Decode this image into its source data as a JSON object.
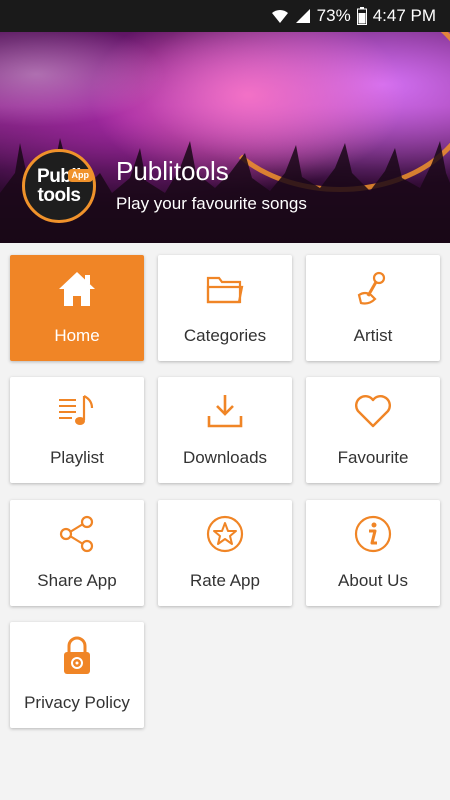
{
  "status_bar": {
    "battery": "73%",
    "time": "4:47 PM"
  },
  "header": {
    "logo_line1": "Publi",
    "logo_line2": "tools",
    "logo_badge": "App",
    "title": "Publitools",
    "subtitle": "Play your favourite songs"
  },
  "menu": [
    {
      "label": "Home",
      "icon": "home-icon",
      "active": true
    },
    {
      "label": "Categories",
      "icon": "folder-icon",
      "active": false
    },
    {
      "label": "Artist",
      "icon": "microphone-icon",
      "active": false
    },
    {
      "label": "Playlist",
      "icon": "playlist-icon",
      "active": false
    },
    {
      "label": "Downloads",
      "icon": "download-icon",
      "active": false
    },
    {
      "label": "Favourite",
      "icon": "heart-icon",
      "active": false
    },
    {
      "label": "Share App",
      "icon": "share-icon",
      "active": false
    },
    {
      "label": "Rate App",
      "icon": "star-icon",
      "active": false
    },
    {
      "label": "About Us",
      "icon": "info-icon",
      "active": false
    },
    {
      "label": "Privacy Policy",
      "icon": "lock-icon",
      "active": false
    }
  ],
  "colors": {
    "accent": "#f08526",
    "status_bar": "#1a1a1a",
    "tile_bg": "#ffffff"
  }
}
